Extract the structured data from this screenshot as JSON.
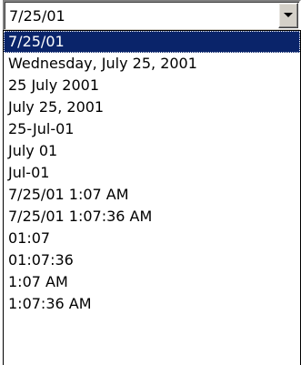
{
  "combo": {
    "value": "7/25/01",
    "button_icon": "chevron-down-icon"
  },
  "list": {
    "selected_index": 0,
    "items": [
      "7/25/01",
      "Wednesday, July 25, 2001",
      "25 July 2001",
      "July 25, 2001",
      "25-Jul-01",
      "July 01",
      "Jul-01",
      "7/25/01 1:07 AM",
      "7/25/01 1:07:36 AM",
      "01:07",
      "01:07:36",
      "1:07 AM",
      "1:07:36 AM"
    ]
  },
  "colors": {
    "selection_background": "#0a246a",
    "selection_text": "#ffffff",
    "button_face": "#d4d0c8"
  }
}
